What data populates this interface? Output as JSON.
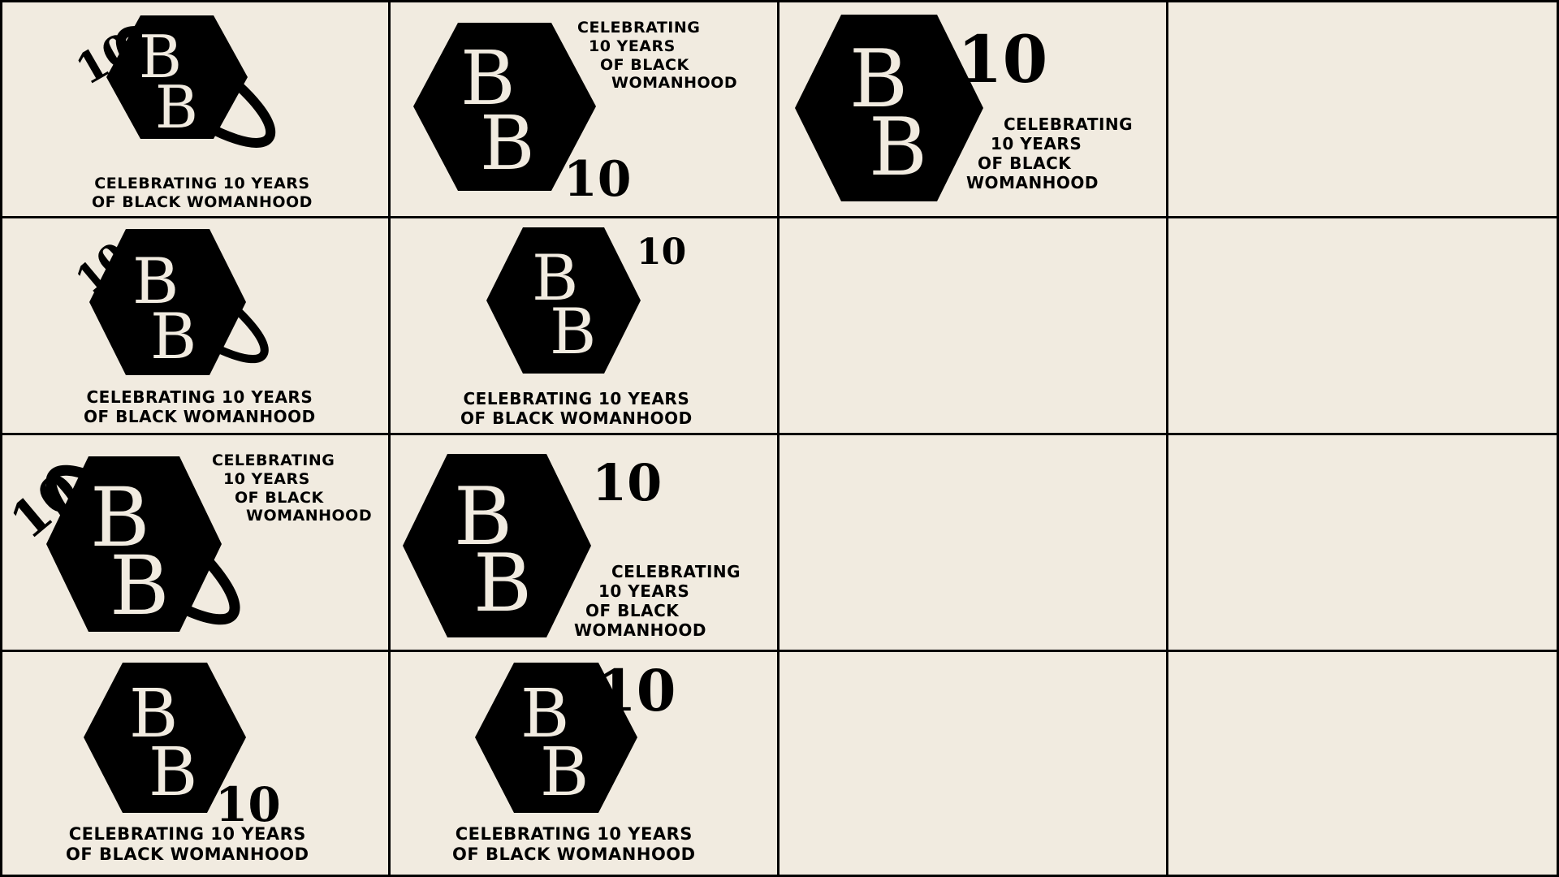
{
  "brand": {
    "monogram_top": "B",
    "monogram_bottom": "B",
    "anniversary": "10",
    "tagline_two_line": [
      "CELEBRATING 10 YEARS",
      "OF BLACK WOMANHOOD"
    ],
    "tagline_four_line": [
      "CELEBRATING",
      "10 YEARS",
      "OF BLACK",
      "WOMANHOOD"
    ]
  },
  "colors": {
    "background": "#f1ebe0",
    "mark": "#000000",
    "grid_line": "#000000"
  }
}
